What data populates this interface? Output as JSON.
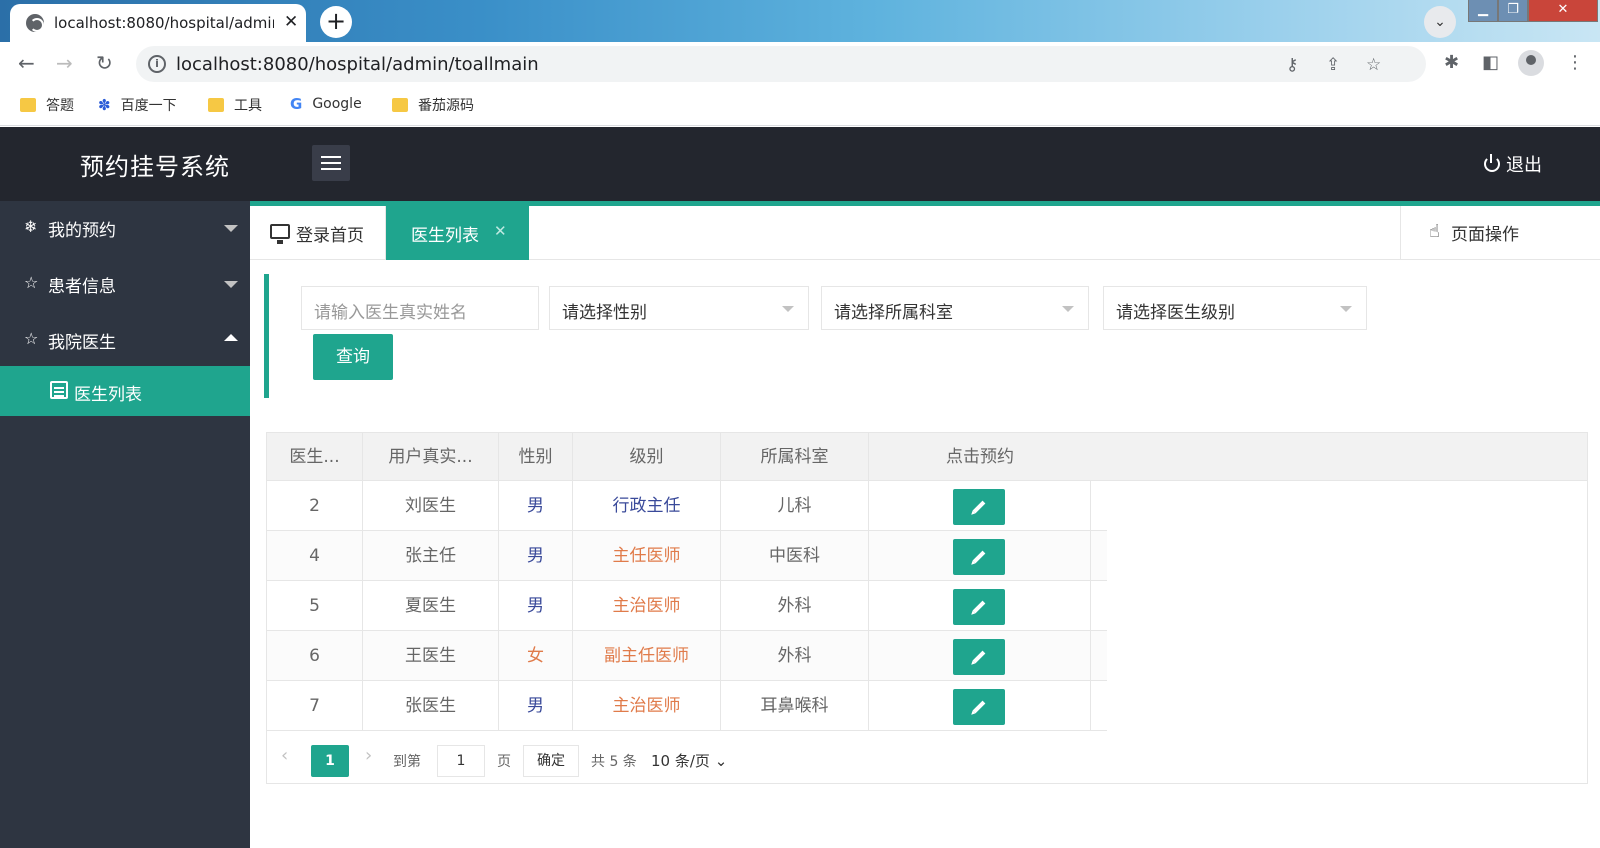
{
  "browser": {
    "tab_title": "localhost:8080/hospital/admin/toallmain",
    "url": "localhost:8080/hospital/admin/toallmain",
    "bookmarks": [
      "答题",
      "百度一下",
      "工具",
      "Google",
      "番茄源码"
    ]
  },
  "header": {
    "app_title": "预约挂号系统",
    "logout_label": "退出"
  },
  "sidebar": {
    "items": [
      {
        "label": "我的预约",
        "icon": "snowflake-icon",
        "expanded": false
      },
      {
        "label": "患者信息",
        "icon": "star-outline-icon",
        "expanded": false
      },
      {
        "label": "我院医生",
        "icon": "star-outline-icon",
        "expanded": true
      }
    ],
    "sub_item": {
      "label": "医生列表",
      "icon": "list-icon"
    }
  },
  "tabs": {
    "home_label": "登录首页",
    "active_label": "医生列表",
    "page_ops_label": "页面操作"
  },
  "filters": {
    "name_placeholder": "请输入医生真实姓名",
    "gender_placeholder": "请选择性别",
    "dept_placeholder": "请选择所属科室",
    "level_placeholder": "请选择医生级别",
    "query_label": "查询"
  },
  "table": {
    "headers": [
      "医生...",
      "用户真实...",
      "性别",
      "级别",
      "所属科室",
      "点击预约"
    ],
    "rows": [
      {
        "id": "2",
        "name": "刘医生",
        "gender": "男",
        "level": "行政主任",
        "dept": "儿科"
      },
      {
        "id": "4",
        "name": "张主任",
        "gender": "男",
        "level": "主任医师",
        "dept": "中医科"
      },
      {
        "id": "5",
        "name": "夏医生",
        "gender": "男",
        "level": "主治医师",
        "dept": "外科"
      },
      {
        "id": "6",
        "name": "王医生",
        "gender": "女",
        "level": "副主任医师",
        "dept": "外科"
      },
      {
        "id": "7",
        "name": "张医生",
        "gender": "男",
        "level": "主治医师",
        "dept": "耳鼻喉科"
      }
    ]
  },
  "pager": {
    "current_page": "1",
    "goto_label": "到第",
    "page_input": "1",
    "page_unit": "页",
    "confirm_label": "确定",
    "total_label": "共 5 条",
    "page_size_label": "10 条/页"
  },
  "colors": {
    "accent": "#1fa58e",
    "header_bg": "#23262e",
    "sidebar_bg": "#2e3541",
    "male_text": "#3a4a9a",
    "female_text": "#e07b4a",
    "level_admin": "#3a4a9a",
    "level_other": "#e07b4a"
  }
}
